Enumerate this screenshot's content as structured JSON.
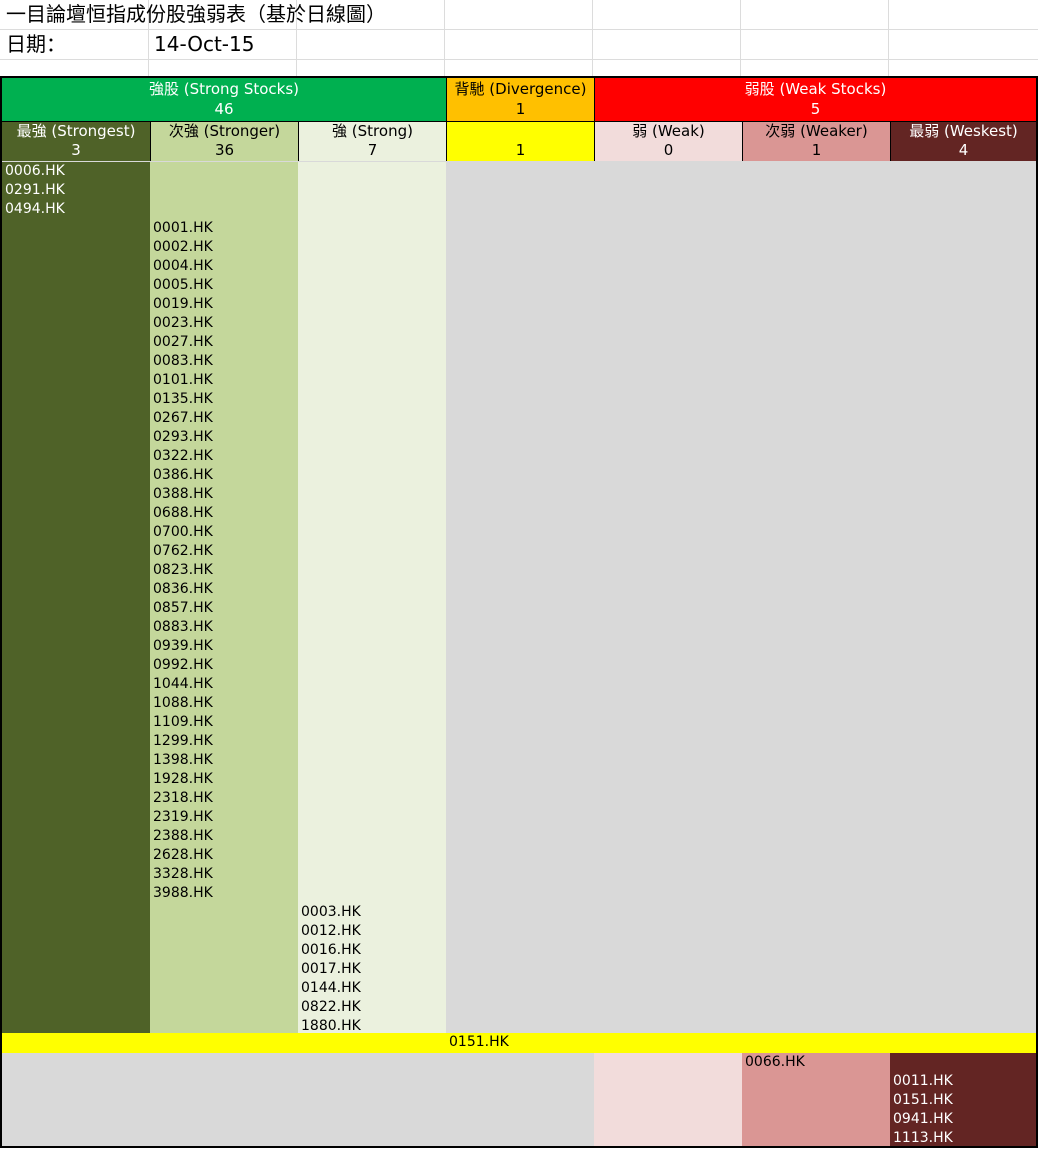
{
  "sheet": {
    "title": "一目論壇恒指成份股強弱表（基於日線圖）",
    "date_label": "日期：",
    "date_value": "14-Oct-15"
  },
  "groups": {
    "strong": {
      "label": "強股 (Strong Stocks)",
      "count": "46"
    },
    "divergence": {
      "label": "背馳 (Divergence)",
      "count": "1"
    },
    "weak": {
      "label": "弱股 (Weak Stocks)",
      "count": "5"
    }
  },
  "categories": [
    {
      "key": "strongest",
      "label": "最強 (Strongest)",
      "count": "3",
      "stocks": [
        "0006.HK",
        "0291.HK",
        "0494.HK"
      ]
    },
    {
      "key": "stronger",
      "label": "次強 (Stronger)",
      "count": "36",
      "stocks": [
        "0001.HK",
        "0002.HK",
        "0004.HK",
        "0005.HK",
        "0019.HK",
        "0023.HK",
        "0027.HK",
        "0083.HK",
        "0101.HK",
        "0135.HK",
        "0267.HK",
        "0293.HK",
        "0322.HK",
        "0386.HK",
        "0388.HK",
        "0688.HK",
        "0700.HK",
        "0762.HK",
        "0823.HK",
        "0836.HK",
        "0857.HK",
        "0883.HK",
        "0939.HK",
        "0992.HK",
        "1044.HK",
        "1088.HK",
        "1109.HK",
        "1299.HK",
        "1398.HK",
        "1928.HK",
        "2318.HK",
        "2319.HK",
        "2388.HK",
        "2628.HK",
        "3328.HK",
        "3988.HK"
      ]
    },
    {
      "key": "strong",
      "label": "強 (Strong)",
      "count": "7",
      "stocks": [
        "0003.HK",
        "0012.HK",
        "0016.HK",
        "0017.HK",
        "0144.HK",
        "0822.HK",
        "1880.HK"
      ]
    },
    {
      "key": "divergence",
      "label": "",
      "count": "1",
      "stocks": [
        "0151.HK"
      ]
    },
    {
      "key": "weak",
      "label": "弱 (Weak)",
      "count": "0",
      "stocks": []
    },
    {
      "key": "weaker",
      "label": "次弱 (Weaker)",
      "count": "1",
      "stocks": [
        "0066.HK"
      ]
    },
    {
      "key": "weakest",
      "label": "最弱 (Weskest)",
      "count": "4",
      "stocks": [
        "0011.HK",
        "0151.HK",
        "0941.HK",
        "1113.HK"
      ]
    }
  ],
  "colors": {
    "strong_group": "#00b050",
    "divergence_group": "#ffc000",
    "weak_group": "#ff0000",
    "strongest": "#4f6228",
    "stronger": "#c4d79b",
    "strong": "#ebf1de",
    "divergence": "#ffff00",
    "weak": "#f2dcdb",
    "weaker": "#da9694",
    "weakest": "#632523",
    "empty": "#d9d9d9"
  }
}
